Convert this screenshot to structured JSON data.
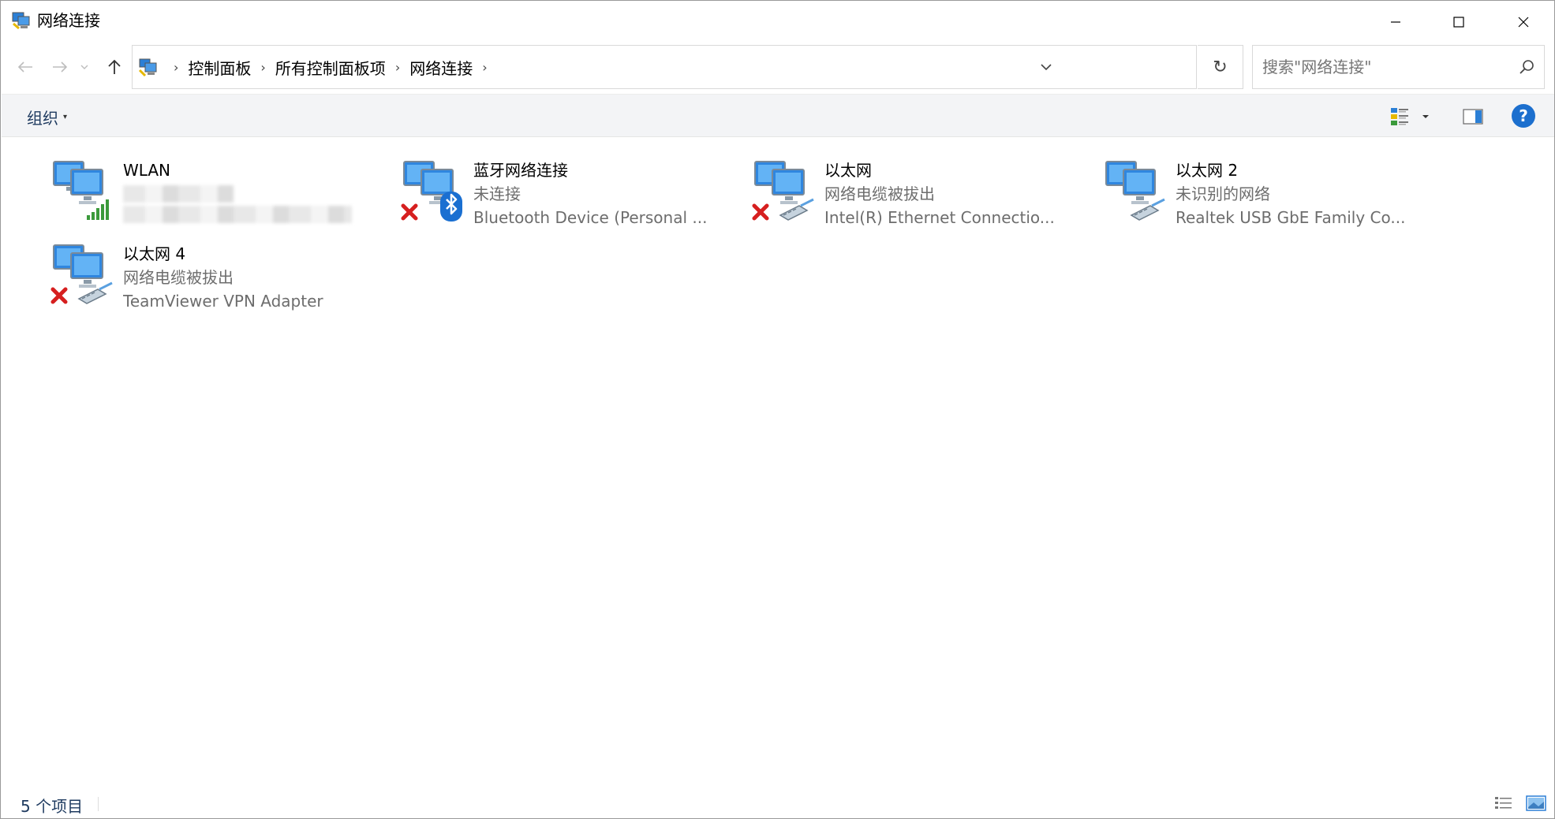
{
  "window": {
    "title": "网络连接",
    "minimize_icon": "minimize-icon",
    "maximize_icon": "maximize-icon",
    "close_icon": "close-icon"
  },
  "nav": {
    "back_icon": "arrow-left-icon",
    "forward_icon": "arrow-right-icon",
    "recent_icon": "chevron-down-icon",
    "up_icon": "arrow-up-icon"
  },
  "address": {
    "crumbs": [
      "控制面板",
      "所有控制面板项",
      "网络连接"
    ],
    "separator": "›",
    "refresh_glyph": "↻"
  },
  "search": {
    "placeholder": "搜索\"网络连接\""
  },
  "commandbar": {
    "organize_label": "组织",
    "organize_caret": "▾",
    "help_label": "?"
  },
  "connections": [
    {
      "name": "WLAN",
      "status": "",
      "device": "",
      "state": "wifi"
    },
    {
      "name": "蓝牙网络连接",
      "status": "未连接",
      "device": "Bluetooth Device (Personal ...",
      "state": "bluetooth-disconnected"
    },
    {
      "name": "以太网",
      "status": "网络电缆被拔出",
      "device": "Intel(R) Ethernet Connectio...",
      "state": "ethernet-unplugged"
    },
    {
      "name": "以太网 2",
      "status": "未识别的网络",
      "device": "Realtek USB GbE Family Co...",
      "state": "ethernet"
    },
    {
      "name": "以太网 4",
      "status": "网络电缆被拔出",
      "device": "TeamViewer VPN Adapter",
      "state": "ethernet-unplugged"
    }
  ],
  "statusbar": {
    "count_text": "5 个项目"
  },
  "colors": {
    "accent": "#1c6fce",
    "cmdbar": "#f3f4f6",
    "secondary_text": "#6d6d6d",
    "error_red": "#d61f1f",
    "wifi_green": "#3b9a3b"
  }
}
